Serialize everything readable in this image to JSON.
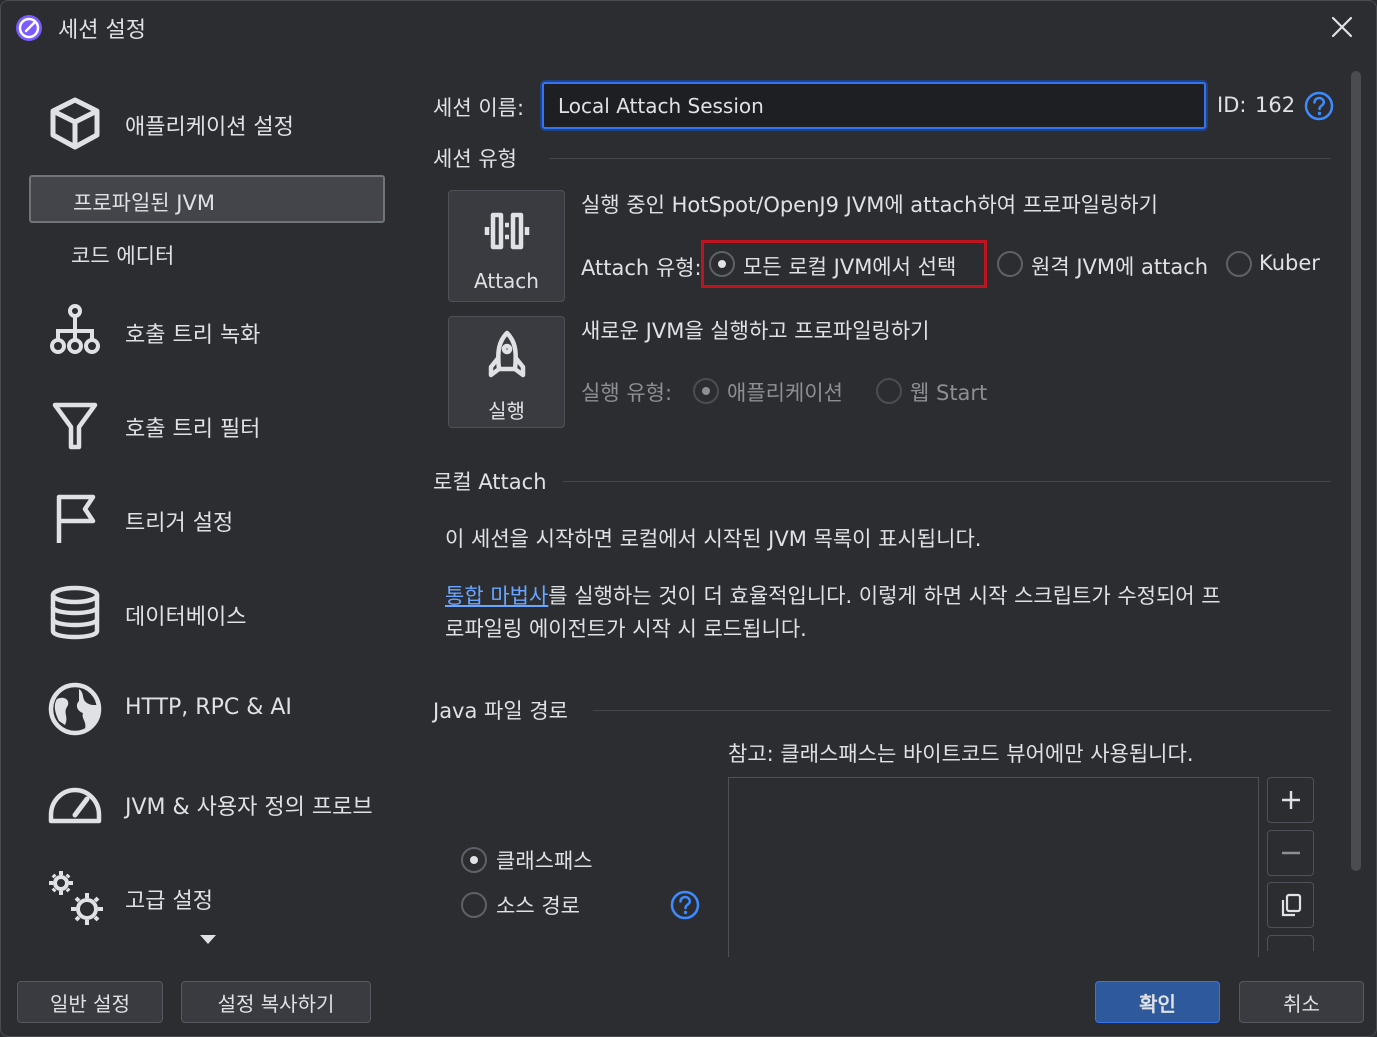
{
  "window": {
    "title": "세션 설정"
  },
  "sidebar": {
    "items": [
      {
        "label": "애플리케이션 설정"
      },
      {
        "label": "호출 트리 녹화"
      },
      {
        "label": "호출 트리 필터"
      },
      {
        "label": "트리거 설정"
      },
      {
        "label": "데이터베이스"
      },
      {
        "label": "HTTP, RPC & AI"
      },
      {
        "label": "JVM & 사용자 정의 프로브"
      },
      {
        "label": "고급 설정"
      }
    ],
    "sub_items": [
      {
        "label": "프로파일된 JVM"
      },
      {
        "label": "코드 에디터"
      }
    ]
  },
  "session": {
    "name_label": "세션 이름:",
    "name_value": "Local Attach Session",
    "id_label": "ID:",
    "id_value": "162"
  },
  "session_type": {
    "heading": "세션 유형",
    "attach": {
      "button_label": "Attach",
      "description": "실행 중인 HotSpot/OpenJ9 JVM에 attach하여 프로파일링하기",
      "type_label": "Attach 유형:",
      "options": [
        "모든 로컬 JVM에서 선택",
        "원격 JVM에 attach",
        "Kuber"
      ]
    },
    "launch": {
      "button_label": "실행",
      "description": "새로운 JVM을 실행하고 프로파일링하기",
      "type_label": "실행 유형:",
      "options": [
        "애플리케이션",
        "웹 Start"
      ]
    }
  },
  "local_attach": {
    "heading": "로컬 Attach",
    "line1": "이 세션을 시작하면 로컬에서 시작된 JVM 목록이 표시됩니다.",
    "link": "통합 마법사",
    "line2a": "를 실행하는 것이 더 효율적입니다. 이렇게 하면 시작 스크립트가 수정되어 프",
    "line2b": "로파일링 에이전트가 시작 시 로드됩니다."
  },
  "java_path": {
    "heading": "Java 파일 경로",
    "note": "참고: 클래스패스는 바이트코드 뷰어에만 사용됩니다.",
    "options": [
      "클래스패스",
      "소스 경로"
    ]
  },
  "buttons": {
    "general": "일반 설정",
    "copy": "설정 복사하기",
    "ok": "확인",
    "cancel": "취소"
  },
  "colors": {
    "accent": "#3574f0",
    "highlight": "#c0121f",
    "link": "#6aa5ff"
  }
}
